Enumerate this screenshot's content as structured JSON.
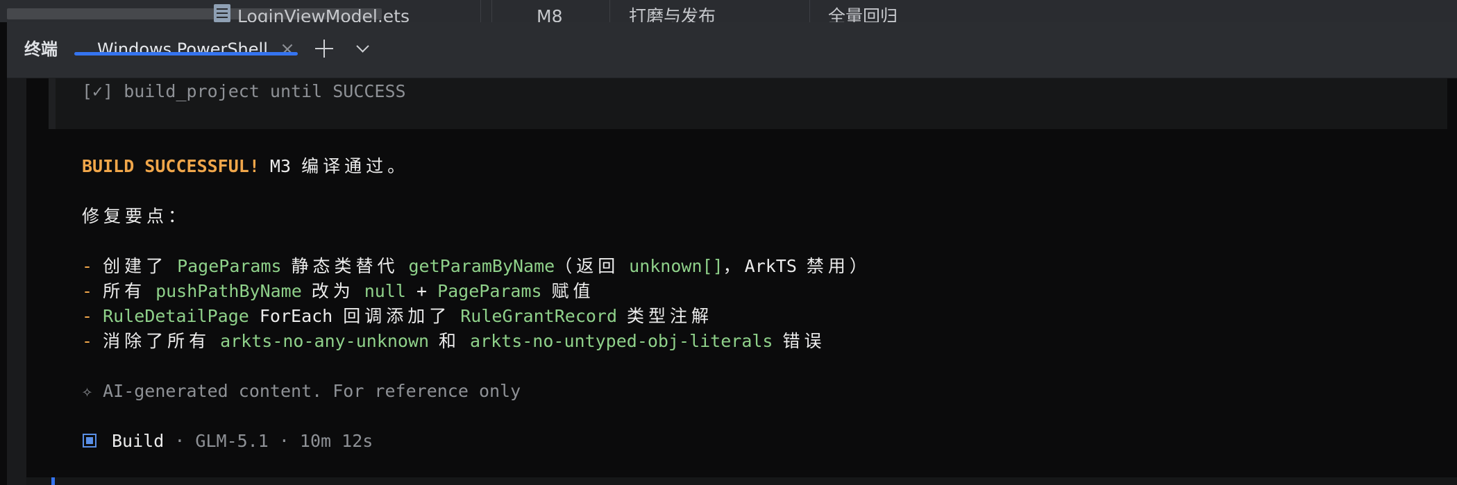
{
  "editor_strip": {
    "file": "LoginViewModel.ets",
    "col_milestone": "M8",
    "col_task": "打磨与发布",
    "col_stage": "全量回归"
  },
  "terminal": {
    "title": "终端",
    "tab_label": "Windows PowerShell",
    "close_symbol": "×"
  },
  "output": {
    "checked_line": "[✓] build_project until SUCCESS",
    "build_success": "BUILD SUCCESSFUL!",
    "build_m3": " M3 ",
    "build_tail": "编译通过。",
    "fixes_heading": "修复要点：",
    "bullet": "- ",
    "fix1": {
      "p1": "创建了 ",
      "p2": "PageParams",
      "p3": " 静态类替代 ",
      "p4": "getParamByName",
      "p5": "（返回 ",
      "p6": "unknown[]",
      "p7": "，",
      "p8": "ArkTS",
      "p9": " 禁用）"
    },
    "fix2": {
      "p1": "所有 ",
      "p2": "pushPathByName",
      "p3": " 改为 ",
      "p4": "null",
      "p5": " + ",
      "p6": "PageParams",
      "p7": " 赋值"
    },
    "fix3": {
      "p1": "RuleDetailPage",
      "p2": " ForEach ",
      "p3": "回调添加了 ",
      "p4": "RuleGrantRecord",
      "p5": " 类型注解"
    },
    "fix4": {
      "p1": "消除了所有 ",
      "p2": "arkts-no-any-unknown",
      "p3": " 和 ",
      "p4": "arkts-no-untyped-obj-literals",
      "p5": " 错误"
    },
    "ai_note": "✧ AI-generated content. For reference only",
    "status_label": "Build",
    "status_meta": " · GLM-5.1 · 10m 12s"
  },
  "colors": {
    "accent": "#3574f0",
    "success": "#f0a64a",
    "code": "#8fd18a"
  }
}
